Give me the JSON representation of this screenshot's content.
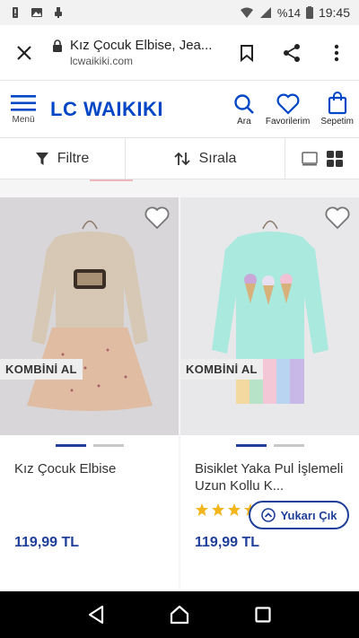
{
  "status_bar": {
    "battery_pct": "%14",
    "time": "19:45"
  },
  "browser": {
    "page_title": "Kız Çocuk Elbise, Jea...",
    "domain": "lcwaikiki.com"
  },
  "header": {
    "menu_label": "Menü",
    "logo_text": "LC WAIKIKI",
    "search_label": "Ara",
    "favorites_label": "Favorilerim",
    "cart_label": "Sepetim"
  },
  "filter_bar": {
    "filter_label": "Filtre",
    "sort_label": "Sırala"
  },
  "products": [
    {
      "name": "Kız Çocuk Elbise",
      "badge": "KOMBİNİ AL",
      "price": "119,99 TL",
      "rating": null
    },
    {
      "name": "Bisiklet Yaka Pul İşlemeli Uzun Kollu K...",
      "badge": "KOMBİNİ AL",
      "price": "119,99 TL",
      "rating": 4
    }
  ],
  "back_to_top": {
    "label": "Yukarı Çık"
  },
  "colors": {
    "brand_blue": "#0046c6",
    "price_blue": "#1f3f9a",
    "nav_black": "#000000"
  }
}
